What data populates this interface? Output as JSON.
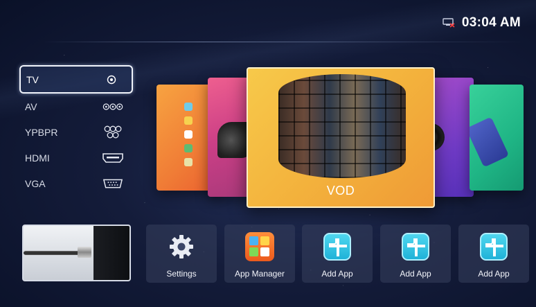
{
  "status": {
    "clock": "03:04 AM",
    "network_icon": "network-disconnected-icon"
  },
  "sources": {
    "items": [
      {
        "label": "TV",
        "icon": "antenna-port-icon",
        "selected": true
      },
      {
        "label": "AV",
        "icon": "av-port-icon",
        "selected": false
      },
      {
        "label": "YPBPR",
        "icon": "component-port-icon",
        "selected": false
      },
      {
        "label": "HDMI",
        "icon": "hdmi-port-icon",
        "selected": false
      },
      {
        "label": "VGA",
        "icon": "vga-port-icon",
        "selected": false
      }
    ]
  },
  "carousel": {
    "focused_label": "VOD",
    "colors": {
      "orange": "#f07d36",
      "pink": "#cb3f86",
      "main": "#f3b13c",
      "purple": "#6e3ac4",
      "green": "#1fb585"
    }
  },
  "tiles": [
    {
      "label": "Settings",
      "icon": "gear-icon"
    },
    {
      "label": "App Manager",
      "icon": "app-manager-icon"
    },
    {
      "label": "Add App",
      "icon": "add-app-icon"
    },
    {
      "label": "Add App",
      "icon": "add-app-icon"
    },
    {
      "label": "Add App",
      "icon": "add-app-icon"
    }
  ]
}
